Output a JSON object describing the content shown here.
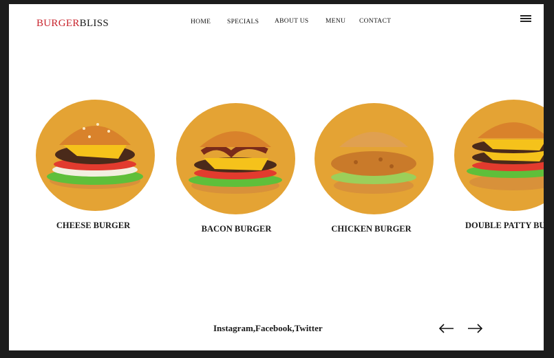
{
  "brand": {
    "part1": "BURGER",
    "part2": "BLISS",
    "color1": "#c8232c",
    "color2": "#1a1a1a"
  },
  "nav": [
    "HOME",
    "SPECIALS",
    "ABOUT US",
    "MENU",
    "CONTACT"
  ],
  "menu_icon": "hamburger-menu-icon",
  "accent": "#e4a334",
  "cards": [
    {
      "title": "CHEESE BURGER",
      "image": "cheese-burger-image"
    },
    {
      "title": "BACON BURGER",
      "image": "bacon-burger-image"
    },
    {
      "title": "CHICKEN BURGER",
      "image": "chicken-burger-image"
    },
    {
      "title": "DOUBLE PATTY BURGER",
      "image": "double-patty-burger-image"
    }
  ],
  "footer": {
    "social": "Instagram,Facebook,Twitter",
    "prev_icon": "arrow-left-icon",
    "next_icon": "arrow-right-icon"
  }
}
